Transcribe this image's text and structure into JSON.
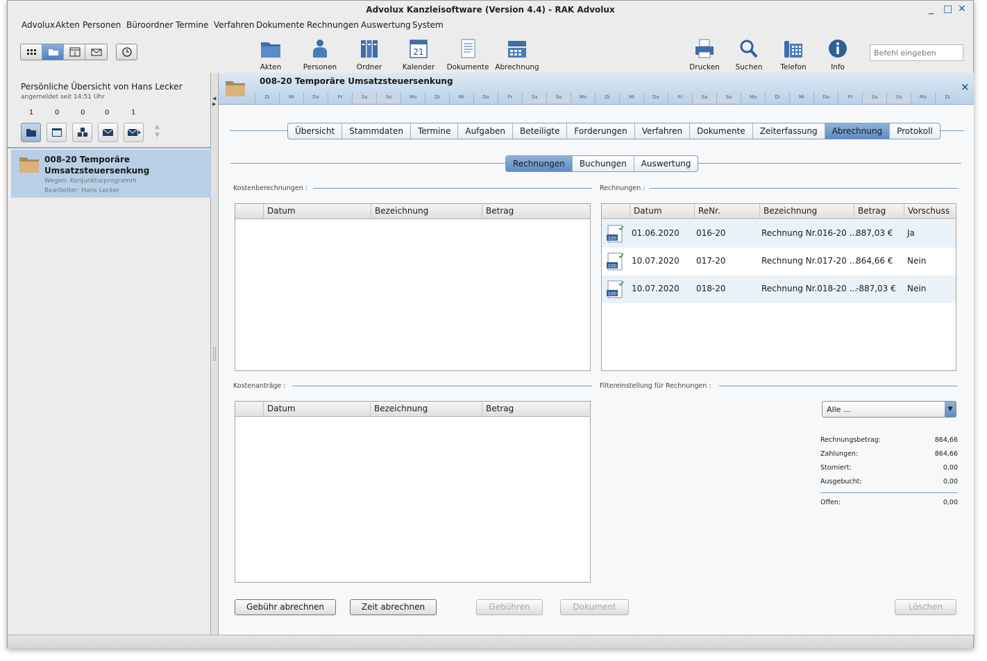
{
  "window": {
    "title": "Advolux Kanzleisoftware (Version 4.4) - RAK Advolux",
    "controls": [
      "_",
      "□",
      "✕"
    ]
  },
  "menu": [
    "Advolux",
    "Akten",
    "Personen",
    "Büroordner",
    "Termine",
    "Verfahren",
    "Dokumente",
    "Rechnungen",
    "Auswertung",
    "System"
  ],
  "toolbar": {
    "center": [
      {
        "label": "Akten",
        "icon": "folder-icon"
      },
      {
        "label": "Personen",
        "icon": "person-icon"
      },
      {
        "label": "Ordner",
        "icon": "binders-icon"
      },
      {
        "label": "Kalender",
        "icon": "calendar-icon",
        "day": "21"
      },
      {
        "label": "Dokumente",
        "icon": "document-icon"
      },
      {
        "label": "Abrechnung",
        "icon": "cash-register-icon"
      }
    ],
    "right": [
      {
        "label": "Drucken",
        "icon": "printer-icon"
      },
      {
        "label": "Suchen",
        "icon": "magnifier-icon"
      },
      {
        "label": "Telefon",
        "icon": "phone-icon"
      },
      {
        "label": "Info",
        "icon": "info-icon"
      }
    ],
    "command_placeholder": "Befehl eingeben"
  },
  "left": {
    "title": "Persönliche Übersicht von Hans Lecker",
    "subtitle": "angemeldet seit 14:51 Uhr",
    "counts": [
      "1",
      "0",
      "0",
      "0",
      "1"
    ],
    "case": {
      "title_line1": "008-20 Temporäre",
      "title_line2": "Umsatzsteuersenkung",
      "wegen": "Wegen: Konjunkturprogramm",
      "bearbeiter": "Bearbeiter: Hans Lecker"
    }
  },
  "case_header": {
    "title": "008-20 Temporäre Umsatzsteuersenkung",
    "days": [
      "Di",
      "Mi",
      "Do",
      "Fr",
      "Sa",
      "So",
      "Mo",
      "Di",
      "Mi",
      "Do",
      "Fr",
      "Sa",
      "So",
      "Mo",
      "Di",
      "Mi",
      "Do",
      "Fr",
      "Sa",
      "So",
      "Mo",
      "Di",
      "Mi",
      "Do",
      "Fr",
      "Sa",
      "So",
      "Mo",
      "Di"
    ]
  },
  "tabs": [
    "Übersicht",
    "Stammdaten",
    "Termine",
    "Aufgaben",
    "Beteiligte",
    "Forderungen",
    "Verfahren",
    "Dokumente",
    "Zeiterfassung",
    "Abrechnung",
    "Protokoll"
  ],
  "subtabs": [
    "Rechnungen",
    "Buchungen",
    "Auswertung"
  ],
  "sections": {
    "kostenberechnungen": "Kostenberechnungen :",
    "rechnungen": "Rechnungen :",
    "kostenantraege": "Kostenanträge :",
    "filter": "Filtereinstellung für Rechnungen :"
  },
  "kosten_columns": [
    "Datum",
    "Bezeichnung",
    "Betrag"
  ],
  "rechnungen_columns": [
    "Datum",
    "ReNr.",
    "Bezeichnung",
    "Betrag",
    "Vorschuss"
  ],
  "rechnungen_rows": [
    {
      "datum": "01.06.2020",
      "renr": "016-20",
      "bezeichnung": "Rechnung Nr.016-20 ...",
      "betrag": "887,03 €",
      "vorschuss": "Ja"
    },
    {
      "datum": "10.07.2020",
      "renr": "017-20",
      "bezeichnung": "Rechnung Nr.017-20 ...",
      "betrag": "864,66 €",
      "vorschuss": "Nein"
    },
    {
      "datum": "10.07.2020",
      "renr": "018-20",
      "bezeichnung": "Rechnung Nr.018-20 ...",
      "betrag": "-887,03 €",
      "vorschuss": "Nein"
    }
  ],
  "invoice_icon_text": "100",
  "filter": {
    "selected": "Alle ..."
  },
  "summary": [
    {
      "label": "Rechnungsbetrag:",
      "value": "864,66"
    },
    {
      "label": "Zahlungen:",
      "value": "864,66"
    },
    {
      "label": "Storniert:",
      "value": "0,00"
    },
    {
      "label": "Ausgebucht:",
      "value": "0,00"
    },
    {
      "label": "Offen:",
      "value": "0,00"
    }
  ],
  "buttons": {
    "gebuehr": "Gebühr abrechnen",
    "zeit": "Zeit abrechnen",
    "gebuehren": "Gebühren",
    "dokument": "Dokument",
    "loeschen": "Löschen"
  },
  "colors": {
    "accent": "#5d8cc4",
    "header_bg": "#b9d1e8",
    "selected_row": "#b8cfe6"
  }
}
